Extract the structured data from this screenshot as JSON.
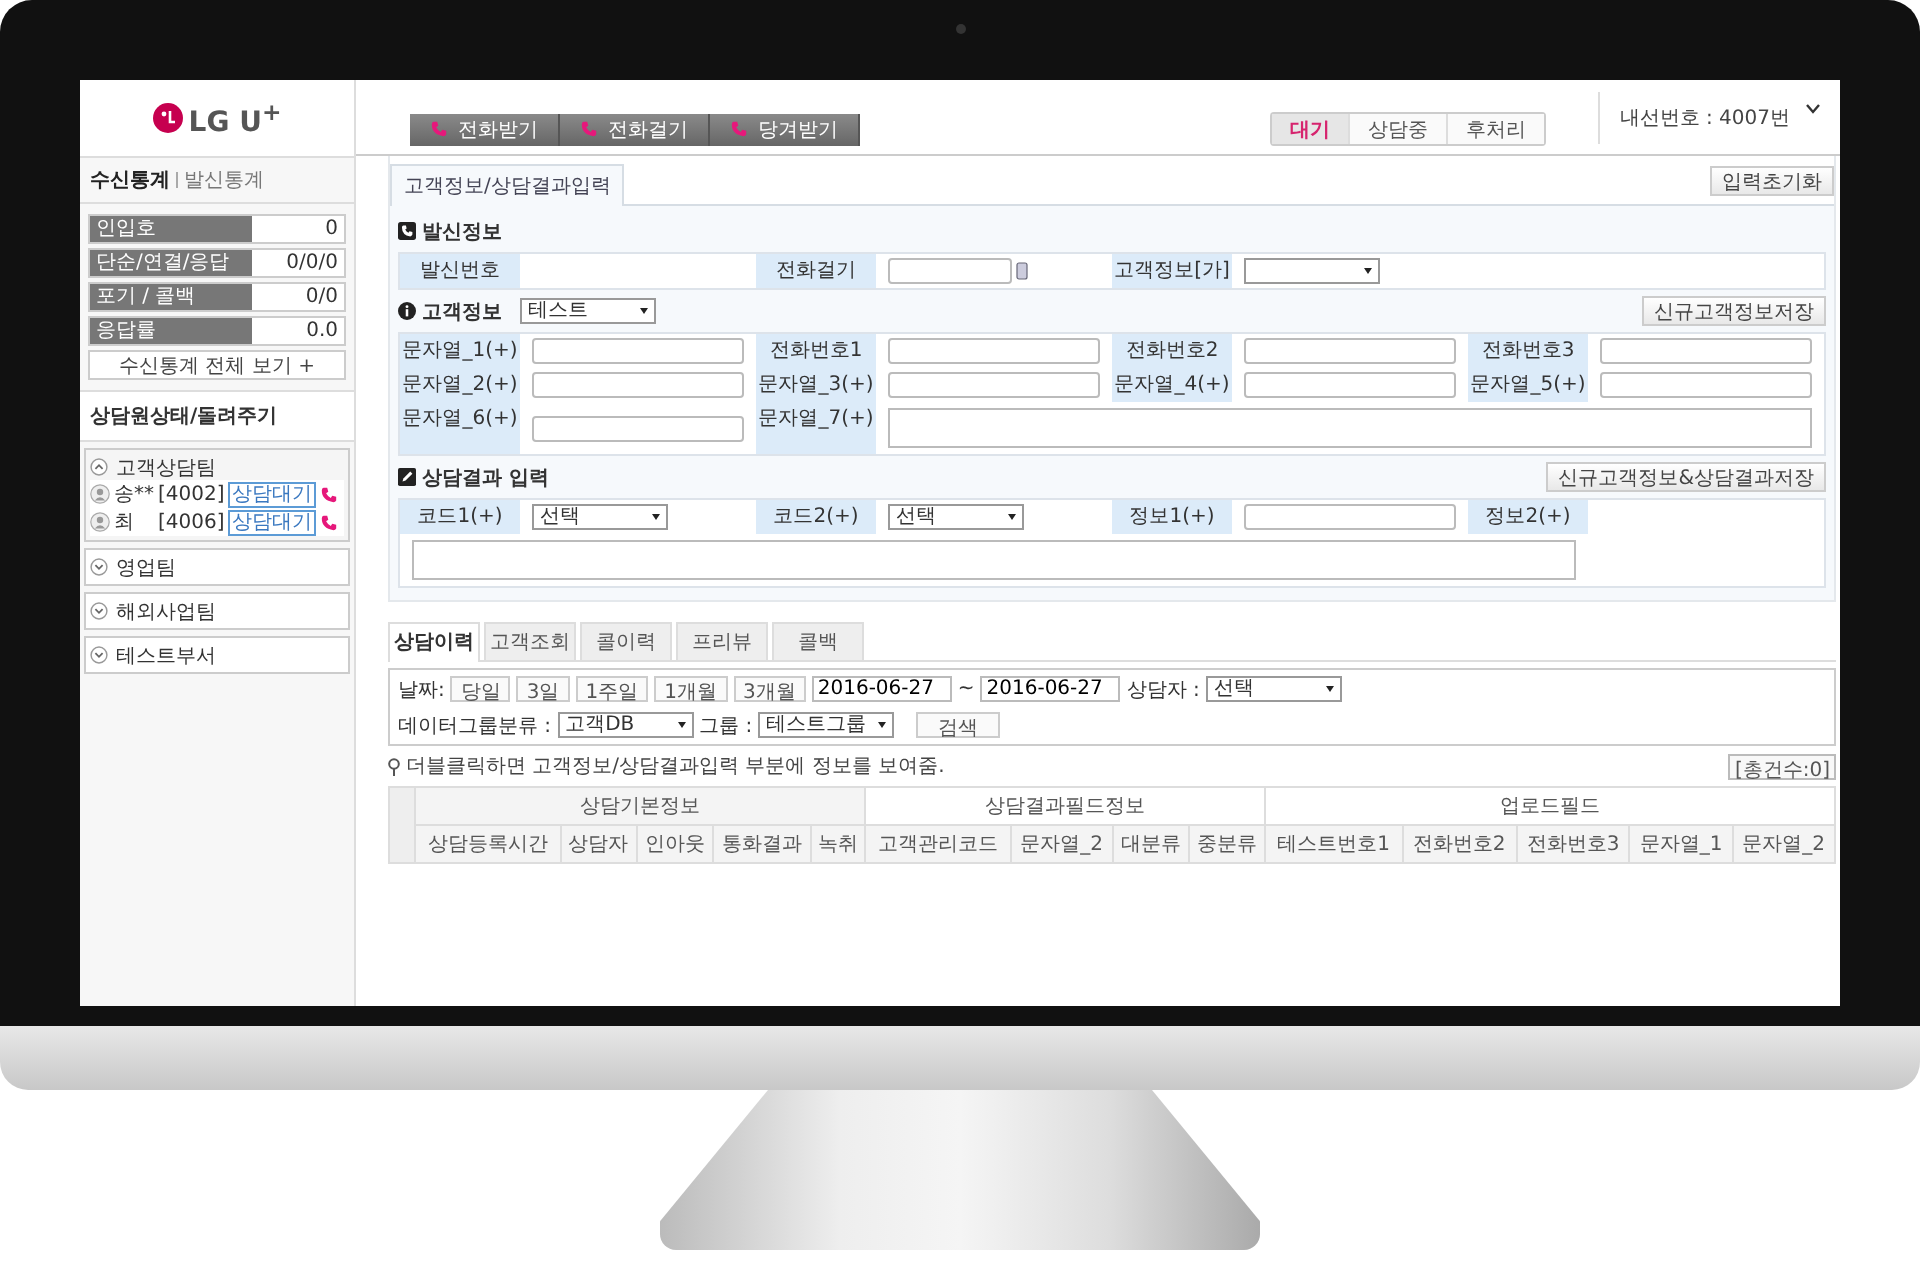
{
  "topbar": {
    "logo": "LG U$^{+}$",
    "call_buttons": [
      {
        "label": "전화받기"
      },
      {
        "label": "전화걸기"
      },
      {
        "label": "당겨받기"
      }
    ],
    "status_tabs": [
      {
        "label": "대기",
        "selected": true
      },
      {
        "label": "상담중",
        "selected": false
      },
      {
        "label": "후처리",
        "selected": false
      }
    ],
    "extension": "내선번호 : 4007번"
  },
  "sidebar": {
    "stats_tabs": [
      {
        "label": "수신통계",
        "selected": true
      },
      {
        "label": "발신통계",
        "selected": false
      }
    ],
    "stats": [
      {
        "label": "인입호",
        "value": "0"
      },
      {
        "label": "단순/연결/응답",
        "value": "0/0/0"
      },
      {
        "label": "포기 / 콜백",
        "value": "0/0"
      },
      {
        "label": "응답률",
        "value": "0.0"
      }
    ],
    "stats_button": "수신통계 전체 보기 +",
    "agents_title": "상담원상태/돌려주기",
    "teams": [
      {
        "name": "고객상담팀",
        "expanded": true,
        "agents": [
          {
            "name": "송**",
            "ext": "[4002]",
            "status": "상담대기"
          },
          {
            "name": "최",
            "ext": "[4006]",
            "status": "상담대기"
          }
        ]
      },
      {
        "name": "영업팀",
        "expanded": false
      },
      {
        "name": "해외사업팀",
        "expanded": false
      },
      {
        "name": "테스트부서",
        "expanded": false
      }
    ]
  },
  "main": {
    "tab": "고객정보/상담결과입력",
    "reset_button": "입력초기화",
    "sections": [
      {
        "kind": "caller",
        "title": "발신정보",
        "rows": [
          [
            {
              "label": "발신번호",
              "kind": "text"
            },
            {
              "label": "전화걸기",
              "kind": "phone"
            },
            {
              "label": "고객정보[가]",
              "kind": "select"
            }
          ]
        ]
      },
      {
        "kind": "customer",
        "title": "고객정보",
        "select": "테스트",
        "button": "신규고객정보저장",
        "rows": [
          [
            {
              "label": "문자열_1(+)",
              "kind": "input"
            },
            {
              "label": "전화번호1",
              "kind": "input"
            },
            {
              "label": "전화번호2",
              "kind": "input"
            },
            {
              "label": "전화번호3",
              "kind": "input"
            }
          ],
          [
            {
              "label": "문자열_2(+)",
              "kind": "input"
            },
            {
              "label": "문자열_3(+)",
              "kind": "input"
            },
            {
              "label": "문자열_4(+)",
              "kind": "input"
            },
            {
              "label": "문자열_5(+)",
              "kind": "input"
            }
          ],
          [
            {
              "label": "문자열_6(+)",
              "kind": "input"
            },
            {
              "label": "문자열_7(+)",
              "kind": "textarea"
            }
          ]
        ]
      },
      {
        "kind": "result",
        "title": "상담결과 입력",
        "button": "신규고객정보&상담결과저장",
        "rows": [
          [
            {
              "label": "코드1(+)",
              "kind": "select",
              "value": "선택"
            },
            {
              "label": "코드2(+)",
              "kind": "select",
              "value": "선택"
            },
            {
              "label": "정보1(+)",
              "kind": "input"
            }
          ],
          [
            {
              "label": "정보2(+)",
              "kind": "textarea"
            }
          ]
        ]
      }
    ]
  },
  "history": {
    "tabs": [
      {
        "label": "상담이력",
        "selected": true
      },
      {
        "label": "고객조회",
        "selected": false
      },
      {
        "label": "콜이력",
        "selected": false
      },
      {
        "label": "프리뷰",
        "selected": false
      },
      {
        "label": "콜백",
        "selected": false
      }
    ],
    "date_label": "날짜:",
    "ranges": [
      "당일",
      "3일",
      "1주일",
      "1개월",
      "3개월"
    ],
    "date_from": "2016-06-27",
    "date_sep": "~",
    "date_to": "2016-06-27",
    "agent_label": "상담자 :",
    "agent_select": "선택",
    "group_type_label": "데이터그룹분류 :",
    "group_type_select": "고객DB",
    "group_label": "그룹 :",
    "group_select": "테스트그룹",
    "search_button": "검색",
    "hint": "더블클릭하면 고객정보/상담결과입력 부분에 정보를 보여줌.",
    "count_button": "[총건수:0]",
    "table": {
      "groups": [
        {
          "label": "상담기본정보",
          "columns": [
            "상담등록시간",
            "상담자",
            "인아웃",
            "통화결과",
            "녹취"
          ]
        },
        {
          "label": "상담결과필드정보",
          "columns": [
            "고객관리코드",
            "문자열_2",
            "대분류",
            "중분류"
          ]
        },
        {
          "label": "업로드필드",
          "columns": [
            "테스트번호1",
            "전화번호2",
            "전화번호3",
            "문자열_1",
            "문자열_2"
          ]
        }
      ]
    }
  }
}
